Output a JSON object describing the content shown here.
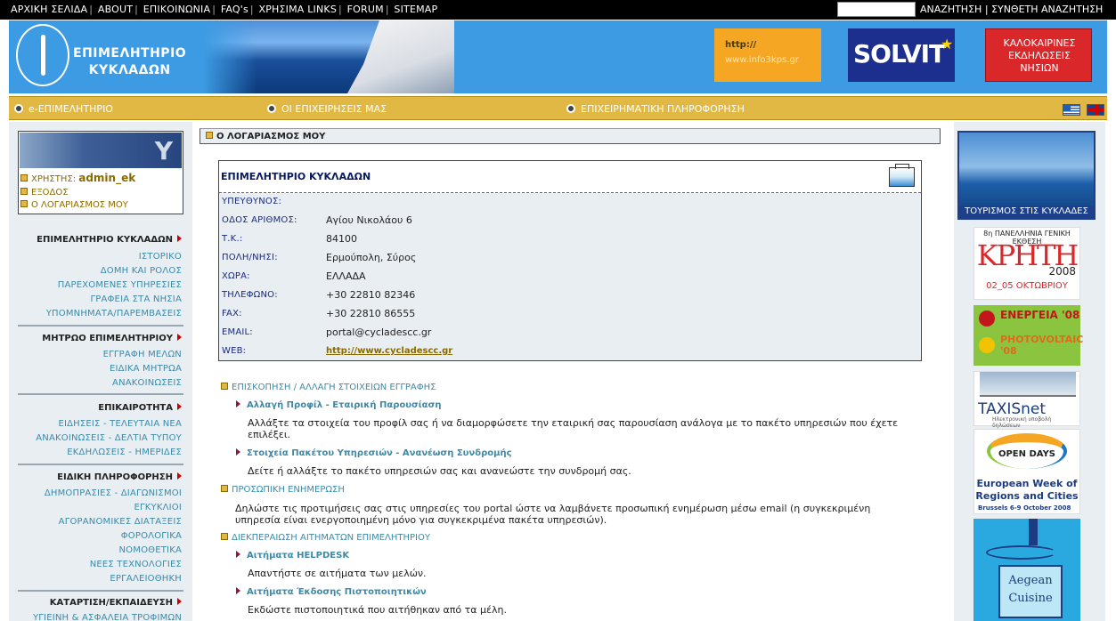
{
  "topbar": {
    "nav": [
      "ΑΡΧΙΚΗ ΣΕΛΙΔΑ",
      "ABOUT",
      "ΕΠΙΚΟΙΝΩΝΙΑ",
      "FAQ's",
      "ΧΡΗΣΙΜΑ LINKS",
      "FORUM",
      "SITEMAP"
    ],
    "search_value": "",
    "search_label": "ΑΝΑΖΗΤΗΣΗ",
    "advanced_search_label": "ΣΥΝΘΕΤΗ ΑΝΑΖΗΤΗΣΗ"
  },
  "header": {
    "logo_line1": "ΕΠΙΜΕΛΗΤΗΡΙΟ",
    "logo_line2": "ΚΥΚΛΑΔΩΝ",
    "banner_info_line1": "http://",
    "banner_info_line2": "www.info3kps.gr",
    "banner_solvit": "SOLVIT",
    "banner_summer": [
      "ΚΑΛΟΚΑΙΡΙΝΕΣ",
      "ΕΚΔΗΛΩΣΕΙΣ",
      "ΝΗΣΙΩΝ"
    ]
  },
  "navbar": {
    "items": [
      "e-ΕΠΙΜΕΛΗΤΗΡΙΟ",
      "ΟΙ ΕΠΙΧΕΙΡΗΣΕΙΣ ΜΑΣ",
      "ΕΠΙΧΕΙΡΗΜΑΤΙΚΗ ΠΛΗΡΟΦΟΡΗΣΗ"
    ]
  },
  "userbox": {
    "user_label": "ΧΡΗΣΤΗΣ:",
    "user_name": "admin_ek",
    "logout": "ΕΞΟΔΟΣ",
    "my_account": "Ο ΛΟΓΑΡΙΑΣΜΟΣ ΜΟΥ"
  },
  "sidebar": {
    "sections": [
      {
        "title": "ΕΠΙΜΕΛΗΤΗΡΙΟ ΚΥΚΛΑΔΩΝ",
        "links": [
          "ΙΣΤΟΡΙΚΟ",
          "ΔΟΜΗ ΚΑΙ ΡΟΛΟΣ",
          "ΠΑΡΕΧΟΜΕΝΕΣ ΥΠΗΡΕΣΙΕΣ",
          "ΓΡΑΦΕΙΑ ΣΤΑ ΝΗΣΙΑ",
          "ΥΠΟΜΝΗΜΑΤΑ/ΠΑΡΕΜΒΑΣΕΙΣ"
        ]
      },
      {
        "title": "ΜΗΤΡΩΟ ΕΠΙΜΕΛΗΤΗΡΙΟΥ",
        "links": [
          "ΕΓΓΡΑΦΗ ΜΕΛΩΝ",
          "ΕΙΔΙΚΑ ΜΗΤΡΩΑ",
          "ΑΝΑΚΟΙΝΩΣΕΙΣ"
        ]
      },
      {
        "title": "ΕΠΙΚΑΙΡΟΤΗΤΑ",
        "links": [
          "ΕΙΔΗΣΕΙΣ - ΤΕΛΕΥΤΑΙΑ ΝΕΑ",
          "ΑΝΑΚΟΙΝΩΣΕΙΣ - ΔΕΛΤΙΑ ΤΥΠΟΥ",
          "ΕΚΔΗΛΩΣΕΙΣ - ΗΜΕΡΙΔΕΣ"
        ]
      },
      {
        "title": "ΕΙΔΙΚΗ ΠΛΗΡΟΦΟΡΗΣΗ",
        "links": [
          "ΔΗΜΟΠΡΑΣΙΕΣ - ΔΙΑΓΩΝΙΣΜΟΙ",
          "ΕΓΚΥΚΛΙΟΙ",
          "ΑΓΟΡΑΝΟΜΙΚΕΣ ΔΙΑΤΑΞΕΙΣ",
          "ΦΟΡΟΛΟΓΙΚΑ",
          "ΝΟΜΟΘΕΤΙΚΑ",
          "ΝΕΕΣ ΤΕΧΝΟΛΟΓΙΕΣ",
          "ΕΡΓΑΛΕΙΟΘΗΚΗ"
        ]
      },
      {
        "title": "ΚΑΤΑΡΤΙΣΗ/ΕΚΠΑΙΔΕΥΣΗ",
        "links": [
          "ΥΓΙΕΙΝΗ & ΑΣΦΑΛΕΙΑ ΤΡΟΦΙΜΩΝ"
        ]
      }
    ]
  },
  "main": {
    "breadcrumb": "Ο ΛΟΓΑΡΙΑΣΜΟΣ ΜΟΥ",
    "card_title": "ΕΠΙΜΕΛΗΤΗΡΙΟ ΚΥΚΛΑΔΩΝ",
    "fields": [
      {
        "label": "ΥΠΕΥΘΥΝΟΣ:",
        "value": ""
      },
      {
        "label": "ΟΔΟΣ ΑΡΙΘΜΟΣ:",
        "value": "Αγίου Νικολάου 6"
      },
      {
        "label": "Τ.Κ.:",
        "value": "84100"
      },
      {
        "label": "ΠΟΛΗ/ΝΗΣΙ:",
        "value": "Ερμούπολη, Σύρος"
      },
      {
        "label": "ΧΩΡΑ:",
        "value": "ΕΛΛΑΔΑ"
      },
      {
        "label": "ΤΗΛΕΦΩΝΟ:",
        "value": "+30 22810 82346"
      },
      {
        "label": "FAX:",
        "value": "+30 22810 86555"
      },
      {
        "label": "EMAIL:",
        "value": "portal@cycladescc.gr"
      },
      {
        "label": "WEB:",
        "value": "http://www.cycladescc.gr"
      }
    ],
    "actions": {
      "edit_heading": "ΕΠΙΣΚΟΠΗΣΗ / ΑΛΛΑΓΗ ΣΤΟΙΧΕΙΩΝ ΕΓΓΡΑΦΗΣ",
      "profile_link": "Αλλαγή Προφίλ - Εταιρική Παρουσίαση",
      "profile_desc": "Αλλάξτε τα στοιχεία του προφίλ σας ή να διαμορφώσετε την εταιρική σας παρουσίαση ανάλογα με το πακέτο υπηρεσιών που έχετε επιλέξει.",
      "package_link": "Στοιχεία Πακέτου Υπηρεσιών - Ανανέωση Συνδρομής",
      "package_desc": "Δείτε ή αλλάξτε το πακέτο υπηρεσιών σας και ανανεώστε την συνδρομή σας.",
      "personal_heading": "ΠΡΟΣΩΠΙΚΗ ΕΝΗΜΕΡΩΣΗ",
      "personal_desc": "Δηλώστε τις προτιμήσεις σας στις υπηρεσίες του portal ώστε να λαμβάνετε προσωπική ενημέρωση μέσω email (η συγκεκριμένη υπηρεσία είναι ενεργοποιημένη μόνο για συγκεκριμένα πακέτα υπηρεσιών).",
      "requests_heading": "ΔΙΕΚΠΕΡΑΙΩΣΗ ΑΙΤΗΜΑΤΩΝ ΕΠΙΜΕΛΗΤΗΡΙΟΥ",
      "helpdesk_link": "Αιτήματα HELPDESK",
      "helpdesk_desc": "Απαντήστε σε αιτήματα των μελών.",
      "cert_link": "Αιτήματα Έκδοσης Πιστοποιητικών",
      "cert_desc": "Εκδώστε πιστοποιητικά που αιτήθηκαν από τα μέλη."
    }
  },
  "rightcol": {
    "tourism_label": "ΤΟΥΡΙΣΜΟΣ ΣΤΙΣ ΚΥΚΛΑΔΕΣ",
    "kriti": {
      "top": "8η ΠΑΝΕΛΛΗΝΙΑ ΓΕΝΙΚΗ ΕΚΘΕΣΗ",
      "name": "ΚΡΗΤΗ",
      "year": "2008",
      "dates": "02_05 ΟΚΤΩΒΡΙΟΥ"
    },
    "energ": {
      "l1": "ΕΝΕΡΓΕΙΑ '08",
      "l2": "PHOTOVOLTAIC '08"
    },
    "taxis": {
      "name": "TAXISnet",
      "sub": "Ηλεκτρονική υποβολή δηλώσεων"
    },
    "open_days": {
      "title": "OPEN DAYS",
      "sub": "European Week of Regions and Cities",
      "place": "Brussels   6-9 October 2008"
    },
    "aegean": "Aegean Cuisine"
  }
}
